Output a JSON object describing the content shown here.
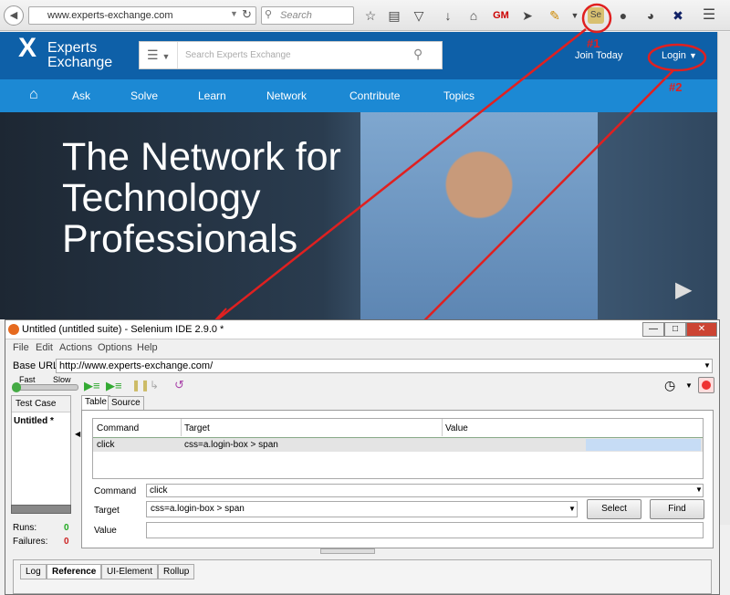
{
  "browser": {
    "url": "www.experts-exchange.com",
    "search_placeholder": "Search",
    "icons": [
      "back-icon",
      "reload-icon",
      "bookmark-star-icon",
      "reader-icon",
      "pocket-icon",
      "download-icon",
      "home-icon",
      "gm-icon",
      "send-icon",
      "brush-icon",
      "dropdown-icon",
      "selenium-addon-icon",
      "chat-icon",
      "dashboard-icon",
      "tool-icon",
      "menu-icon"
    ]
  },
  "site": {
    "logo_line1": "Experts",
    "logo_line2": "Exchange",
    "search_placeholder": "Search Experts Exchange",
    "join_label": "Join Today",
    "login_label": "Login",
    "nav": [
      "Ask",
      "Solve",
      "Learn",
      "Network",
      "Contribute",
      "Topics"
    ],
    "hero_title": "The Network for Technology Professionals"
  },
  "annotations": {
    "marker1": "#1",
    "marker2": "#2",
    "color": "#e02020"
  },
  "selenium": {
    "title": "Untitled (untitled suite) - Selenium IDE 2.9.0 *",
    "menu": [
      "File",
      "Edit",
      "Actions",
      "Options",
      "Help"
    ],
    "base_url_label": "Base URL",
    "base_url": "http://www.experts-exchange.com/",
    "speed_fast": "Fast",
    "speed_slow": "Slow",
    "testcase_header": "Test Case",
    "testcase_item": "Untitled *",
    "runs_label": "Runs:",
    "runs_value": "0",
    "failures_label": "Failures:",
    "failures_value": "0",
    "tabs": [
      "Table",
      "Source"
    ],
    "columns": [
      "Command",
      "Target",
      "Value"
    ],
    "rows": [
      {
        "command": "click",
        "target": "css=a.login-box > span",
        "value": ""
      }
    ],
    "command_label": "Command",
    "command_value": "click",
    "target_label": "Target",
    "target_value": "css=a.login-box > span",
    "value_label": "Value",
    "value_value": "",
    "select_button": "Select",
    "find_button": "Find",
    "bottom_tabs": [
      "Log",
      "Reference",
      "UI-Element",
      "Rollup"
    ]
  }
}
